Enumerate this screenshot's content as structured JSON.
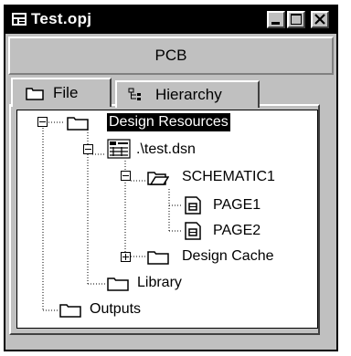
{
  "window": {
    "title": "Test.opj"
  },
  "toolbar": {
    "label": "PCB"
  },
  "tabs": [
    {
      "label": "File"
    },
    {
      "label": "Hierarchy"
    }
  ],
  "tree": {
    "design_resources": "Design Resources",
    "dsn": ".\\test.dsn",
    "schematic": "SCHEMATIC1",
    "page1": "PAGE1",
    "page2": "PAGE2",
    "design_cache": "Design Cache",
    "library": "Library",
    "outputs": "Outputs"
  },
  "icons": {
    "app": "project-icon",
    "minimize": "minimize-icon",
    "maximize": "maximize-icon",
    "close": "close-icon"
  },
  "colors": {
    "titlebar": "#000000",
    "window": "#c0c0c0",
    "selection": "#000000"
  }
}
